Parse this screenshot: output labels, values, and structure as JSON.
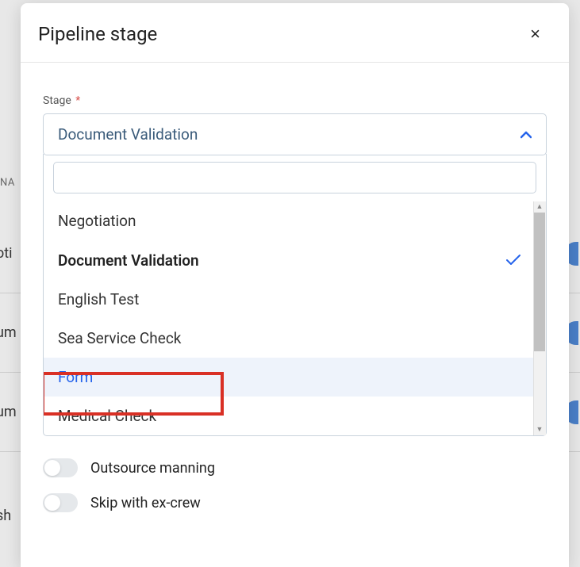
{
  "background": {
    "header": "NA",
    "rows": [
      "oti",
      "um",
      "um",
      "sh"
    ]
  },
  "modal": {
    "title": "Pipeline stage",
    "close_icon": "×"
  },
  "field": {
    "label": "Stage",
    "required": "*"
  },
  "select": {
    "value": "Document Validation",
    "search_value": "",
    "options": [
      {
        "label": "Negotiation",
        "selected": false,
        "highlighted": false
      },
      {
        "label": "Document Validation",
        "selected": true,
        "highlighted": false
      },
      {
        "label": "English Test",
        "selected": false,
        "highlighted": false
      },
      {
        "label": "Sea Service Check",
        "selected": false,
        "highlighted": false
      },
      {
        "label": "Form",
        "selected": false,
        "highlighted": true
      },
      {
        "label": "Medical Check",
        "selected": false,
        "highlighted": false
      }
    ]
  },
  "toggles": [
    {
      "label": "Outsource manning"
    },
    {
      "label": "Skip with ex-crew"
    }
  ]
}
